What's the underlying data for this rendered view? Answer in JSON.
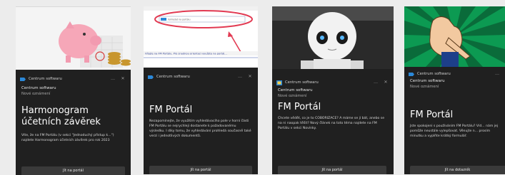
{
  "cards": [
    {
      "app_name": "Centrum softwaru",
      "sender": "Centrum softwaru",
      "subtitle": "Nové oznámení",
      "headline": "Harmonogram účetních závěrek",
      "body": "Víte, že na FM Portálu (v sekci \"Jednoduchý přístup k...\") najdete Harmonogram účetních závěrek pro rok 2023",
      "cta": "Jít na portál"
    },
    {
      "app_name": "Centrum softwaru",
      "sender": "",
      "subtitle": "",
      "headline": "FM Portál",
      "body": "Nezapomínejte, že využitím vyhledávacího pole v horní části FM Portálu se nejrychleji dostanete k požadovanému výsledku. I díky tomu, že vyhledávání prohledá současně také verzi i jednotlivých dokumentů.",
      "cta": "Jít na portál",
      "banner": "Vítejte na FM Portálu. Pro snadnou orientaci využijte na portál..."
    },
    {
      "app_name": "Centrum softwaru",
      "sender": "Centrum softwaru",
      "subtitle": "Nové oznámení",
      "headline": "FM Portál",
      "body": "Chcete vědět, co je to COBORIZACE? A máme se jí bát, anebo se na ni naopak těšit? Nový článek na toto téma najdete na FM Portálu v sekci Novinky.",
      "cta": "Jít na portál"
    },
    {
      "app_name": "Centrum softwaru",
      "sender": "Centrum softwaru",
      "subtitle": "Nové oznámení",
      "headline": "FM Portál",
      "body": "Jste spokojeni s používáním FM Portálu? Víd... nám jej pomůže neustále vylepšovat. Věnujte n... prosím minutku a vyplňte krátký formulář.",
      "cta": "Jít na dotazník"
    }
  ],
  "colors": {
    "accent": "#2b88d8",
    "panel": "#202020",
    "button": "#3a3a3a",
    "circle": "#e23a52"
  },
  "icons": [
    "app-icon",
    "minimize-icon",
    "close-icon",
    "piggy-bank-image",
    "robot-image",
    "pointing-hand-image",
    "portal-screenshot-image"
  ]
}
